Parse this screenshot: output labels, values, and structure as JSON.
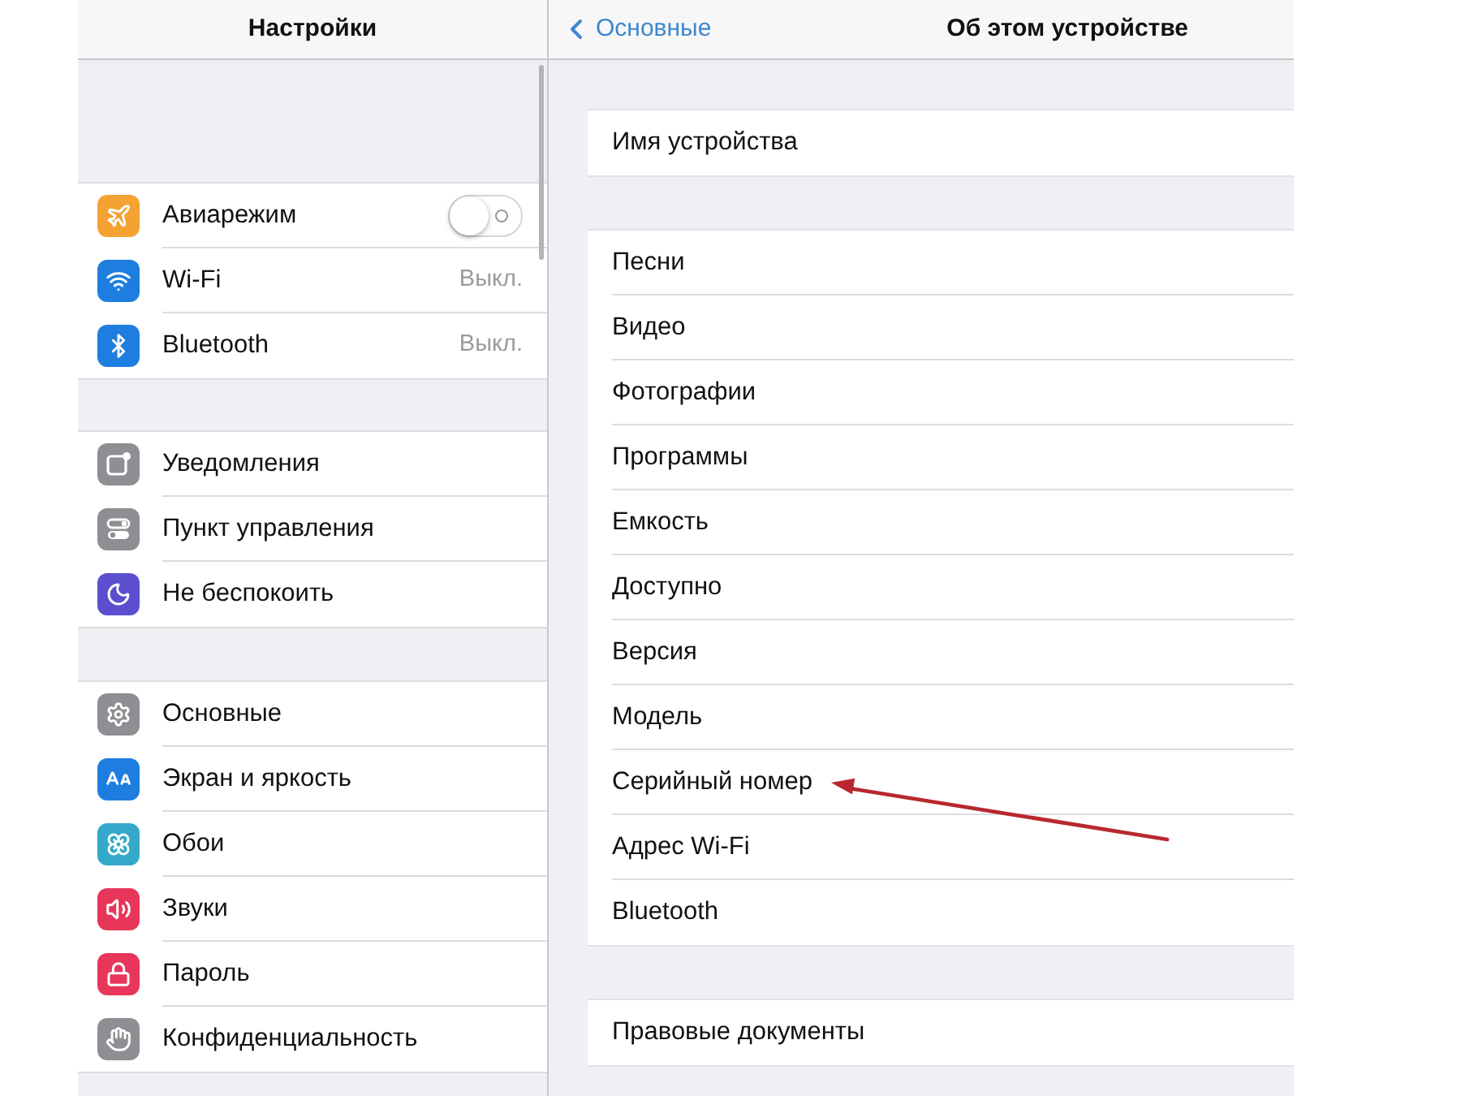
{
  "sidebar": {
    "title": "Настройки",
    "groups": [
      {
        "items": [
          {
            "kind": "toggle",
            "label": "Авиарежим",
            "color": "#f4a232",
            "on": false
          },
          {
            "kind": "value",
            "label": "Wi-Fi",
            "color": "#1d7ee0",
            "value": "Выкл."
          },
          {
            "kind": "value",
            "label": "Bluetooth",
            "color": "#1d7ee0",
            "value": "Выкл."
          }
        ]
      },
      {
        "items": [
          {
            "kind": "link",
            "label": "Уведомления",
            "color": "#8e8e93"
          },
          {
            "kind": "link",
            "label": "Пункт управления",
            "color": "#8e8e93"
          },
          {
            "kind": "link",
            "label": "Не беспокоить",
            "color": "#5b4fd0"
          }
        ]
      },
      {
        "items": [
          {
            "kind": "link",
            "label": "Основные",
            "color": "#8e8e93"
          },
          {
            "kind": "link",
            "label": "Экран и яркость",
            "color": "#1d7ee0"
          },
          {
            "kind": "link",
            "label": "Обои",
            "color": "#34a9c9"
          },
          {
            "kind": "link",
            "label": "Звуки",
            "color": "#e8365a"
          },
          {
            "kind": "link",
            "label": "Пароль",
            "color": "#e8365a"
          },
          {
            "kind": "link",
            "label": "Конфиденциальность",
            "color": "#8e8e93"
          }
        ]
      }
    ]
  },
  "detail": {
    "back": "Основные",
    "title": "Об этом устройстве",
    "groups": [
      {
        "items": [
          {
            "label": "Имя устройства"
          }
        ]
      },
      {
        "items": [
          {
            "label": "Песни"
          },
          {
            "label": "Видео"
          },
          {
            "label": "Фотографии"
          },
          {
            "label": "Программы"
          },
          {
            "label": "Емкость"
          },
          {
            "label": "Доступно"
          },
          {
            "label": "Версия"
          },
          {
            "label": "Модель"
          },
          {
            "label": "Серийный номер"
          },
          {
            "label": "Адрес Wi-Fi"
          },
          {
            "label": "Bluetooth"
          }
        ]
      },
      {
        "items": [
          {
            "label": "Правовые документы"
          }
        ]
      }
    ]
  }
}
